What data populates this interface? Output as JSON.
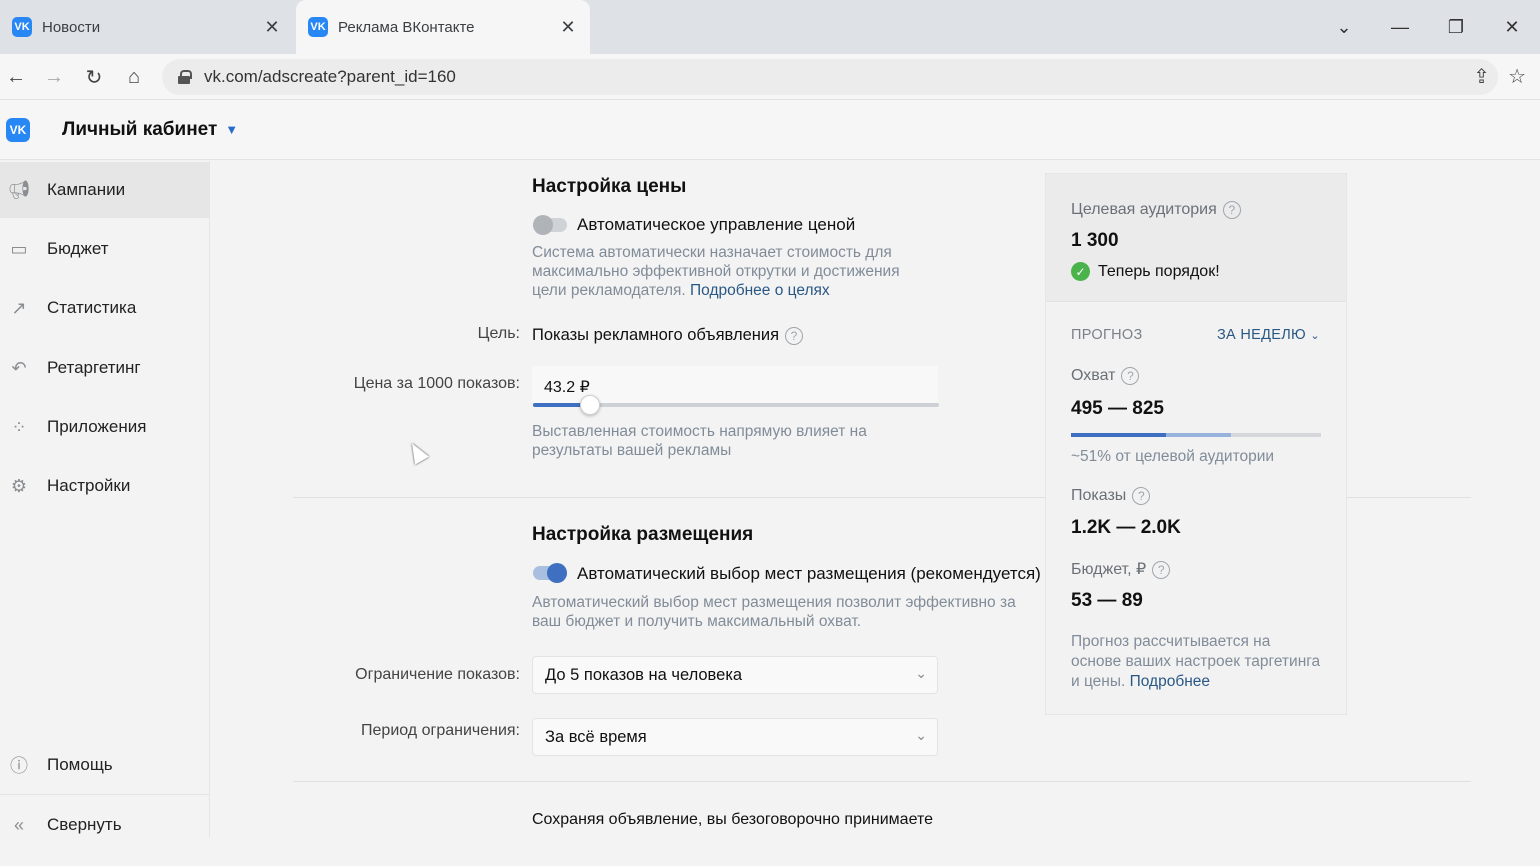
{
  "browser": {
    "tabs": [
      {
        "title": "Новости",
        "active": false
      },
      {
        "title": "Реклама ВКонтакте",
        "active": true
      }
    ],
    "url": "vk.com/adscreate?parent_id=160"
  },
  "header": {
    "logo": "VK",
    "title": "Личный кабинет"
  },
  "sidebar": {
    "items": [
      {
        "label": "Кампании",
        "icon": "megaphone-icon",
        "active": true
      },
      {
        "label": "Бюджет",
        "icon": "wallet-icon"
      },
      {
        "label": "Статистика",
        "icon": "chart-icon"
      },
      {
        "label": "Ретаргетинг",
        "icon": "retarget-icon"
      },
      {
        "label": "Приложения",
        "icon": "apps-icon"
      },
      {
        "label": "Настройки",
        "icon": "gear-icon"
      }
    ],
    "bottom": [
      {
        "label": "Помощь",
        "icon": "help-icon"
      },
      {
        "label": "Свернуть",
        "icon": "collapse-icon"
      }
    ]
  },
  "price": {
    "heading": "Настройка цены",
    "auto_label": "Автоматическое управление ценой",
    "auto_on": false,
    "hint": "Система автоматически назначает стоимость для максимально эффективной открутки и достижения цели рекламодателя.",
    "hint_link": "Подробнее о целях",
    "goal_label": "Цель:",
    "goal_value": "Показы рекламного объявления",
    "cpm_label": "Цена за 1000 показов:",
    "cpm_value": "43.2 ₽",
    "slider_fraction": 0.14,
    "cpm_hint": "Выставленная стоимость напрямую влияет на результаты вашей рекламы"
  },
  "placement": {
    "heading": "Настройка размещения",
    "auto_label": "Автоматический выбор мест размещения (рекомендуется)",
    "auto_on": true,
    "hint": "Автоматический выбор мест размещения позволит эффективно за ваш бюджет и получить максимальный охват.",
    "limit_label": "Ограничение показов:",
    "limit_value": "До 5 показов на человека",
    "period_label": "Период ограничения:",
    "period_value": "За всё время"
  },
  "footer_text": "Сохраняя объявление, вы безоговорочно принимаете",
  "forecast": {
    "audience_label": "Целевая аудитория",
    "audience_value": "1 300",
    "status": "Теперь порядок!",
    "forecast_label": "ПРОГНОЗ",
    "period": "ЗА НЕДЕЛЮ",
    "reach_label": "Охват",
    "reach_value": "495 — 825",
    "reach_low_fraction": 0.38,
    "reach_high_fraction": 0.64,
    "reach_note": "~51% от целевой аудитории",
    "impressions_label": "Показы",
    "impressions_value": "1.2K — 2.0K",
    "budget_label": "Бюджет, ₽",
    "budget_value": "53 — 89",
    "note": "Прогноз рассчитывается на основе ваших настроек таргетинга и цены.",
    "note_link": "Подробнее"
  },
  "colors": {
    "accent": "#2a5885",
    "vk_blue": "#2787f5",
    "toggle_on": "#3f6fc0",
    "ok_green": "#4bb34b"
  }
}
